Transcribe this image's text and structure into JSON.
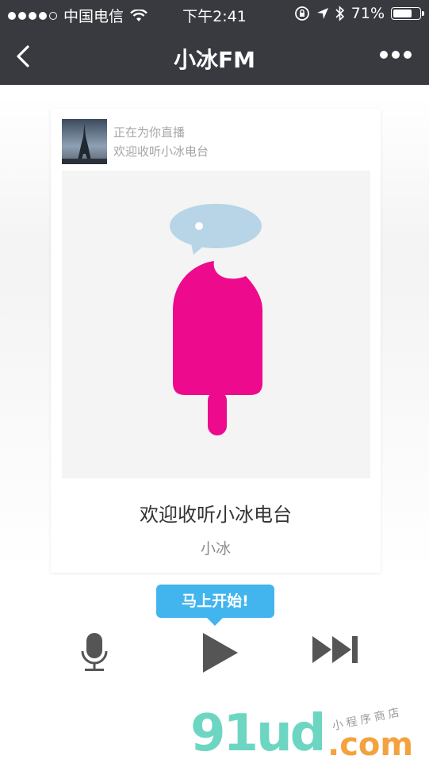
{
  "status_bar": {
    "carrier": "中国电信",
    "time": "下午2:41",
    "battery": "71%",
    "battery_level": 0.71,
    "icons": [
      "signal-dots-icon",
      "wifi-icon",
      "rotation-lock-icon",
      "location-arrow-icon",
      "bluetooth-icon",
      "battery-icon"
    ]
  },
  "nav": {
    "title": "小冰FM",
    "back_icon": "chevron-left-icon",
    "more_icon": "more-dots-icon"
  },
  "card": {
    "live_line1": "正在为你直播",
    "live_line2": "欢迎收听小冰电台",
    "song_title": "欢迎收听小冰电台",
    "artist": "小冰",
    "colors": {
      "popsicle": "#ee0a8c",
      "bubble": "#b7d5e6",
      "art_bg": "#f4f4f4"
    }
  },
  "player": {
    "tooltip": "马上开始!",
    "tooltip_color": "#42b4ee",
    "icons": [
      "microphone-icon",
      "play-icon",
      "skip-forward-icon"
    ]
  },
  "watermark": {
    "main": "91ud",
    "suffix": ".com",
    "tagline": "小程序商店"
  }
}
